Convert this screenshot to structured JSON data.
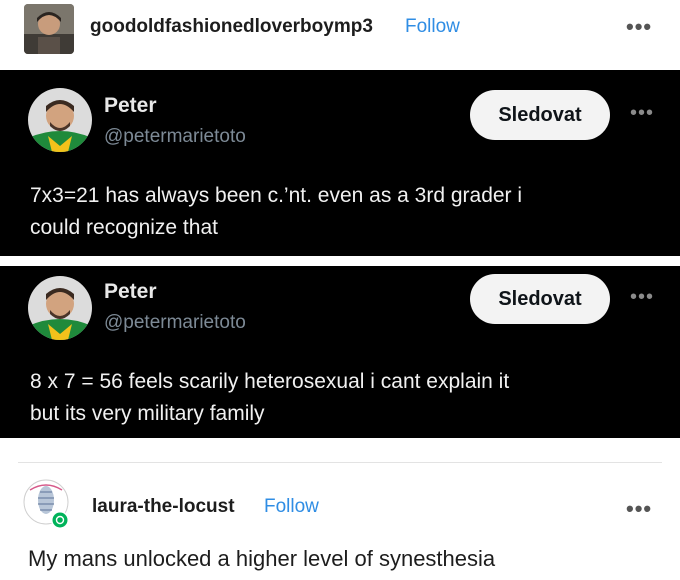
{
  "post": {
    "blog_name": "goodoldfashionedloverboymp3",
    "follow_label": "Follow",
    "more_icon": "•••"
  },
  "tweets": [
    {
      "name": "Peter",
      "handle": "@petermarietoto",
      "follow_label": "Sledovat",
      "more_icon": "•••",
      "lines": [
        "7x3=21 has always been c.’nt. even as a 3rd grader i",
        "could recognize that"
      ]
    },
    {
      "name": "Peter",
      "handle": "@petermarietoto",
      "follow_label": "Sledovat",
      "more_icon": "•••",
      "lines": [
        "8 x 7 = 56 feels scarily heterosexual i cant explain it",
        "but its very military family"
      ]
    }
  ],
  "reblog": {
    "blog_name": "laura-the-locust",
    "follow_label": "Follow",
    "more_icon": "•••",
    "text": "My mans unlocked a higher level of synesthesia"
  },
  "colors": {
    "follow_link": "#2f8de4",
    "tweet_bg": "#000000",
    "handle": "#7d8a96",
    "jersey_green": "#1f8a3b",
    "jersey_yellow": "#f2c21b"
  }
}
